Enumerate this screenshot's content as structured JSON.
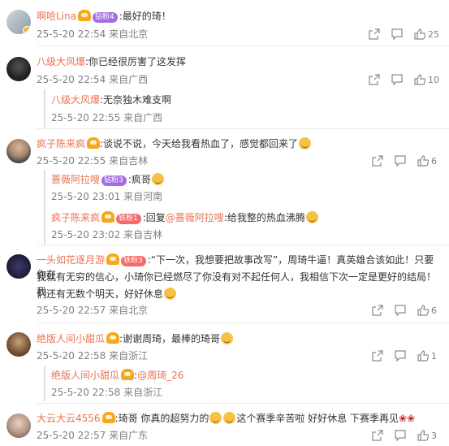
{
  "comments": [
    {
      "user": "啊哈Lina",
      "tag": "钻粉4",
      "text": ":最好的琦！",
      "time": "25-5-20 22:54",
      "location": "来自北京",
      "likes": "25"
    },
    {
      "user": "八级大风爆",
      "text": ":你已经很厉害了这发挥",
      "time": "25-5-20 22:54",
      "location": "来自广西",
      "likes": "10",
      "replies": [
        {
          "user": "八级大风爆",
          "text": ":无奈独木难支啊",
          "time": "25-5-20 22:55",
          "location": "来自广西"
        }
      ]
    },
    {
      "user": "疯子陈来疯",
      "text": ":谈说不说，今天给我看热血了，感觉都回来了",
      "time": "25-5-20 22:55",
      "location": "来自吉林",
      "likes": "6",
      "replies": [
        {
          "user": "蔷薇阿拉嗖",
          "tag": "钻粉3",
          "text": ":疯哥",
          "time": "25-5-20 23:01",
          "location": "来自河南"
        },
        {
          "user": "疯子陈来疯",
          "tag": "铁粉1",
          "text_prefix": ":回复",
          "mention": "@蔷薇阿拉嗖",
          "text": ":给我整的热血沸腾",
          "time": "25-5-20 23:02",
          "location": "来自吉林"
        }
      ]
    },
    {
      "user": "一头如花逐月游",
      "tag": "铁粉3",
      "text_line1": ":“下一次，我想要把故事改写”，周琦牛逼！真英雄合该如此！只要你在",
      "text_line2": "我就有无穷的信心，小琦你已经燃尽了你没有对不起任何人，我相信下次一定是更好的结局！我",
      "text_line3": "们还有无数个明天，好好休息",
      "time": "25-5-20 22:57",
      "location": "来自北京",
      "likes": "6"
    },
    {
      "user": "绝版人间小甜瓜",
      "text": ":谢谢周琦，最棒的琦哥",
      "time": "25-5-20 22:58",
      "location": "来自浙江",
      "likes": "1",
      "replies": [
        {
          "user": "绝版人间小甜瓜",
          "text_prefix": ":",
          "mention": "@周琦_26",
          "text": "",
          "time": "25-5-20 22:58",
          "location": "来自浙江"
        }
      ]
    },
    {
      "user": "大云大云4556",
      "text_a": ":琦哥 你真的超努力的",
      "text_b": "这个赛季辛苦啦 好好休息 下赛季再见",
      "time": "25-5-20 22:57",
      "location": "来自广东",
      "likes": "3"
    }
  ],
  "icons": [
    "share-icon",
    "comment-icon",
    "like-icon"
  ],
  "colors": {
    "username": "#eb7350",
    "meta": "#808080",
    "reply_bg": "#f5f5f5"
  }
}
